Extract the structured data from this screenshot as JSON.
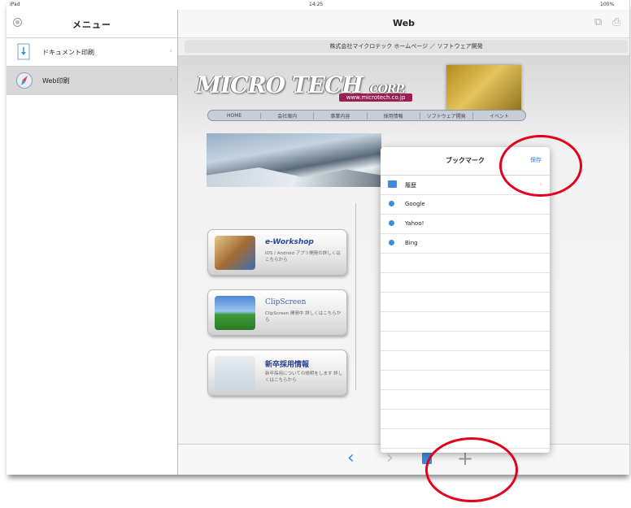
{
  "status": {
    "carrier": "iPad",
    "time": "14:25",
    "battery": "100%"
  },
  "sidebar": {
    "title": "メニュー",
    "items": [
      {
        "label": "ドキュメント印刷",
        "icon": "document-print-icon",
        "selected": false
      },
      {
        "label": "Web印刷",
        "icon": "safari-compass-icon",
        "selected": true
      }
    ]
  },
  "navbar": {
    "title": "Web"
  },
  "urlbar": {
    "text": "株式会社マイクロテック ホームページ ／ ソフトウェア開発"
  },
  "site": {
    "logo": "MICRO TECH",
    "logo_corp": "CORP.",
    "logo_url": "www.microtech.co.jp",
    "nav_tabs": [
      "HOME",
      "会社案内",
      "事業内容",
      "採用情報",
      "ソフトウェア開発",
      "イベント"
    ],
    "cards": [
      {
        "title": "e-Workshop",
        "desc": "iOS / Android アプリ開発の詳しくはこちらから"
      },
      {
        "title": "ClipScreen",
        "desc": "ClipScreen 開発中 詳しくはこちらから"
      },
      {
        "title": "新卒採用情報",
        "desc": "新卒採用についての説明をします 詳しくはこちらから"
      }
    ]
  },
  "bookmarks": {
    "title": "ブックマーク",
    "save_label": "保存",
    "items": [
      {
        "label": "履歴",
        "type": "folder"
      },
      {
        "label": "Google",
        "type": "link"
      },
      {
        "label": "Yahoo!",
        "type": "link"
      },
      {
        "label": "Bing",
        "type": "link"
      }
    ]
  },
  "toolbar": {
    "back": "‹",
    "forward": "›",
    "add": "+"
  },
  "colors": {
    "accent": "#2f7ddc",
    "highlight": "#e3001b",
    "selected_row": "#d7d7d7"
  }
}
